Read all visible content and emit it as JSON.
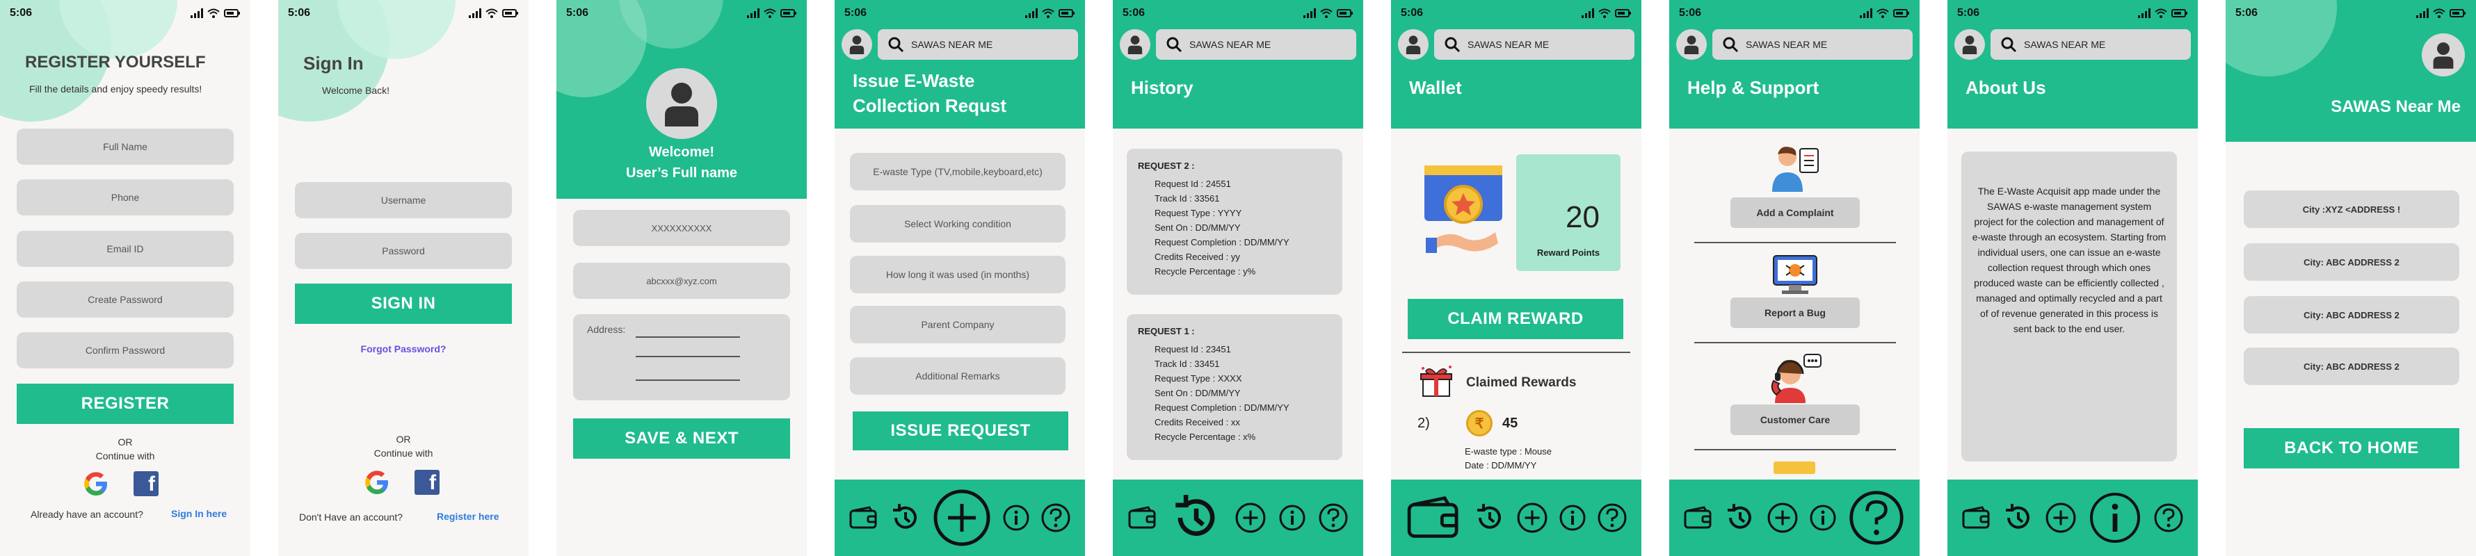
{
  "status": {
    "time": "5:06"
  },
  "register": {
    "title": "REGISTER YOURSELF",
    "subtitle": "Fill the details and enjoy speedy results!",
    "fields": [
      "Full Name",
      "Phone",
      "Email ID",
      "Create Password",
      "Confirm Password"
    ],
    "button": "REGISTER",
    "or": "OR",
    "continue": "Continue with",
    "footer": "Already have an account?",
    "footer_link": "Sign In here"
  },
  "signin": {
    "title": "Sign In",
    "subtitle": "Welcome Back!",
    "fields": [
      "Username",
      "Password"
    ],
    "button": "SIGN IN",
    "forgot": "Forgot Password?",
    "or": "OR",
    "continue": "Continue with",
    "footer": "Don't Have an account?",
    "footer_link": "Register here"
  },
  "profile": {
    "welcome": "Welcome!",
    "name": "User’s  Full name",
    "phone": "XXXXXXXXXX",
    "email": "abcxxx@xyz.com",
    "address_label": "Address:",
    "button": "SAVE & NEXT"
  },
  "search": {
    "placeholder": "SAWAS NEAR ME"
  },
  "issue": {
    "title_l1": "Issue E-Waste",
    "title_l2": "Collection Requst",
    "fields": [
      "E-waste Type (TV,mobile,keyboard,etc)",
      "Select Working condition",
      "How long it was used (in months)",
      "Parent Company",
      "Additional Remarks"
    ],
    "button": "ISSUE REQUEST"
  },
  "history": {
    "title": "History",
    "requests": [
      {
        "title": "REQUEST 2 :",
        "lines": [
          "Request Id : 24551",
          "Track Id : 33561",
          "Request Type : YYYY",
          "Sent On : DD/MM/YY",
          "Request Completion : DD/MM/YY",
          "Credits Received : yy",
          "Recycle Percentage : y%"
        ]
      },
      {
        "title": "REQUEST 1 :",
        "lines": [
          "Request Id : 23451",
          "Track Id : 33451",
          "Request Type : XXXX",
          "Sent On : DD/MM/YY",
          "Request Completion : DD/MM/YY",
          "Credits Received : xx",
          "Recycle Percentage : x%"
        ]
      }
    ]
  },
  "wallet": {
    "title": "Wallet",
    "points": "20",
    "points_label": "Reward Points",
    "button": "CLAIM REWARD",
    "claimed_title": "Claimed Rewards",
    "claim_index": "2)",
    "claim_value": "45",
    "ewaste_type": "E-waste type : Mouse",
    "date": "Date : DD/MM/YY"
  },
  "help": {
    "title": "Help & Support",
    "buttons": [
      "Add a Complaint",
      "Report a Bug",
      "Customer Care"
    ]
  },
  "about": {
    "title": "About Us",
    "text": "The E-Waste Acquisit app made under the SAWAS  e-waste management system project for the colection and management of e-waste through an ecosystem. Starting from individual users, one can issue an e-waste collection request through which ones produced waste can be efficiently collected , managed and optimally recycled and a part of of revenue generated in this process is sent back to the end user."
  },
  "near": {
    "title": "SAWAS Near Me",
    "cities": [
      "City :XYZ <ADDRESS !",
      "City: ABC ADDRESS 2",
      "City: ABC ADDRESS 2",
      "City: ABC ADDRESS 2"
    ],
    "button": "BACK TO HOME"
  },
  "colors": {
    "primary": "#20bc8d",
    "field": "#d9d9d9",
    "background": "#f8f6f4"
  }
}
